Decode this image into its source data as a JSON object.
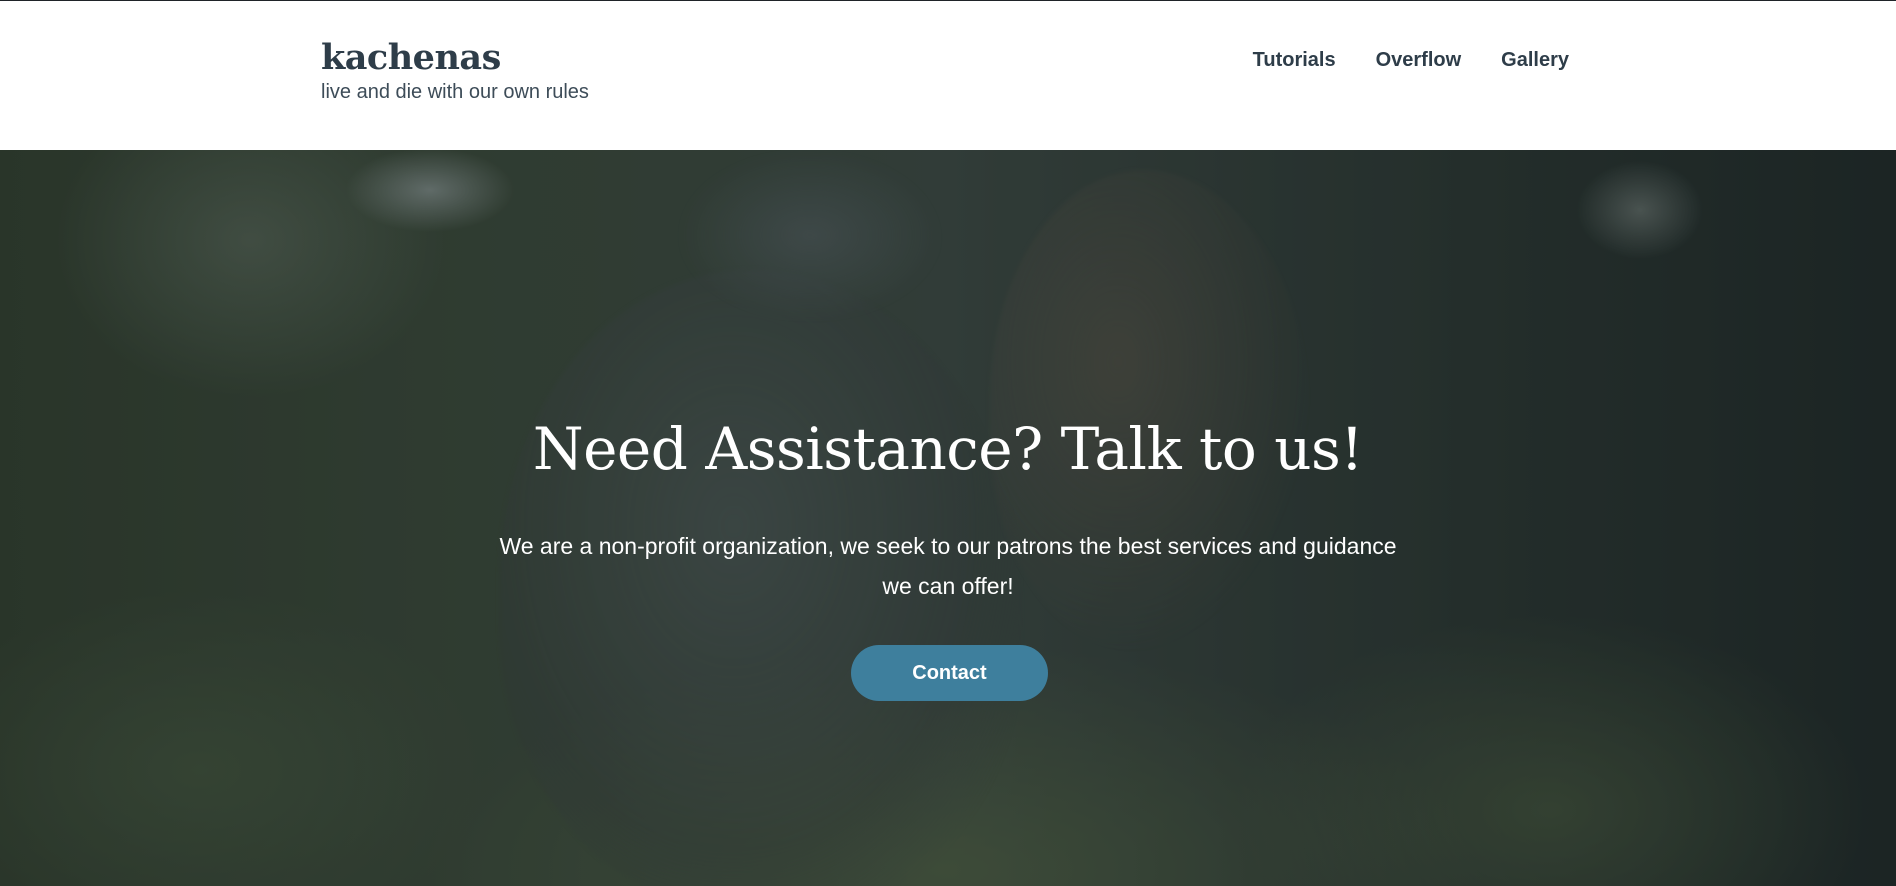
{
  "site": {
    "title": "kachenas",
    "tagline": "live and die with our own rules"
  },
  "nav": {
    "items": [
      {
        "label": "Tutorials"
      },
      {
        "label": "Overflow"
      },
      {
        "label": "Gallery"
      }
    ]
  },
  "hero": {
    "heading": "Need Assistance? Talk to us!",
    "text": "We are a non-profit organization, we seek to our patrons the best services and guidance we can offer!",
    "button_label": "Contact",
    "button_color": "#3e7f9d"
  },
  "colors": {
    "text_dark": "#2e3d49",
    "background": "#ffffff"
  }
}
